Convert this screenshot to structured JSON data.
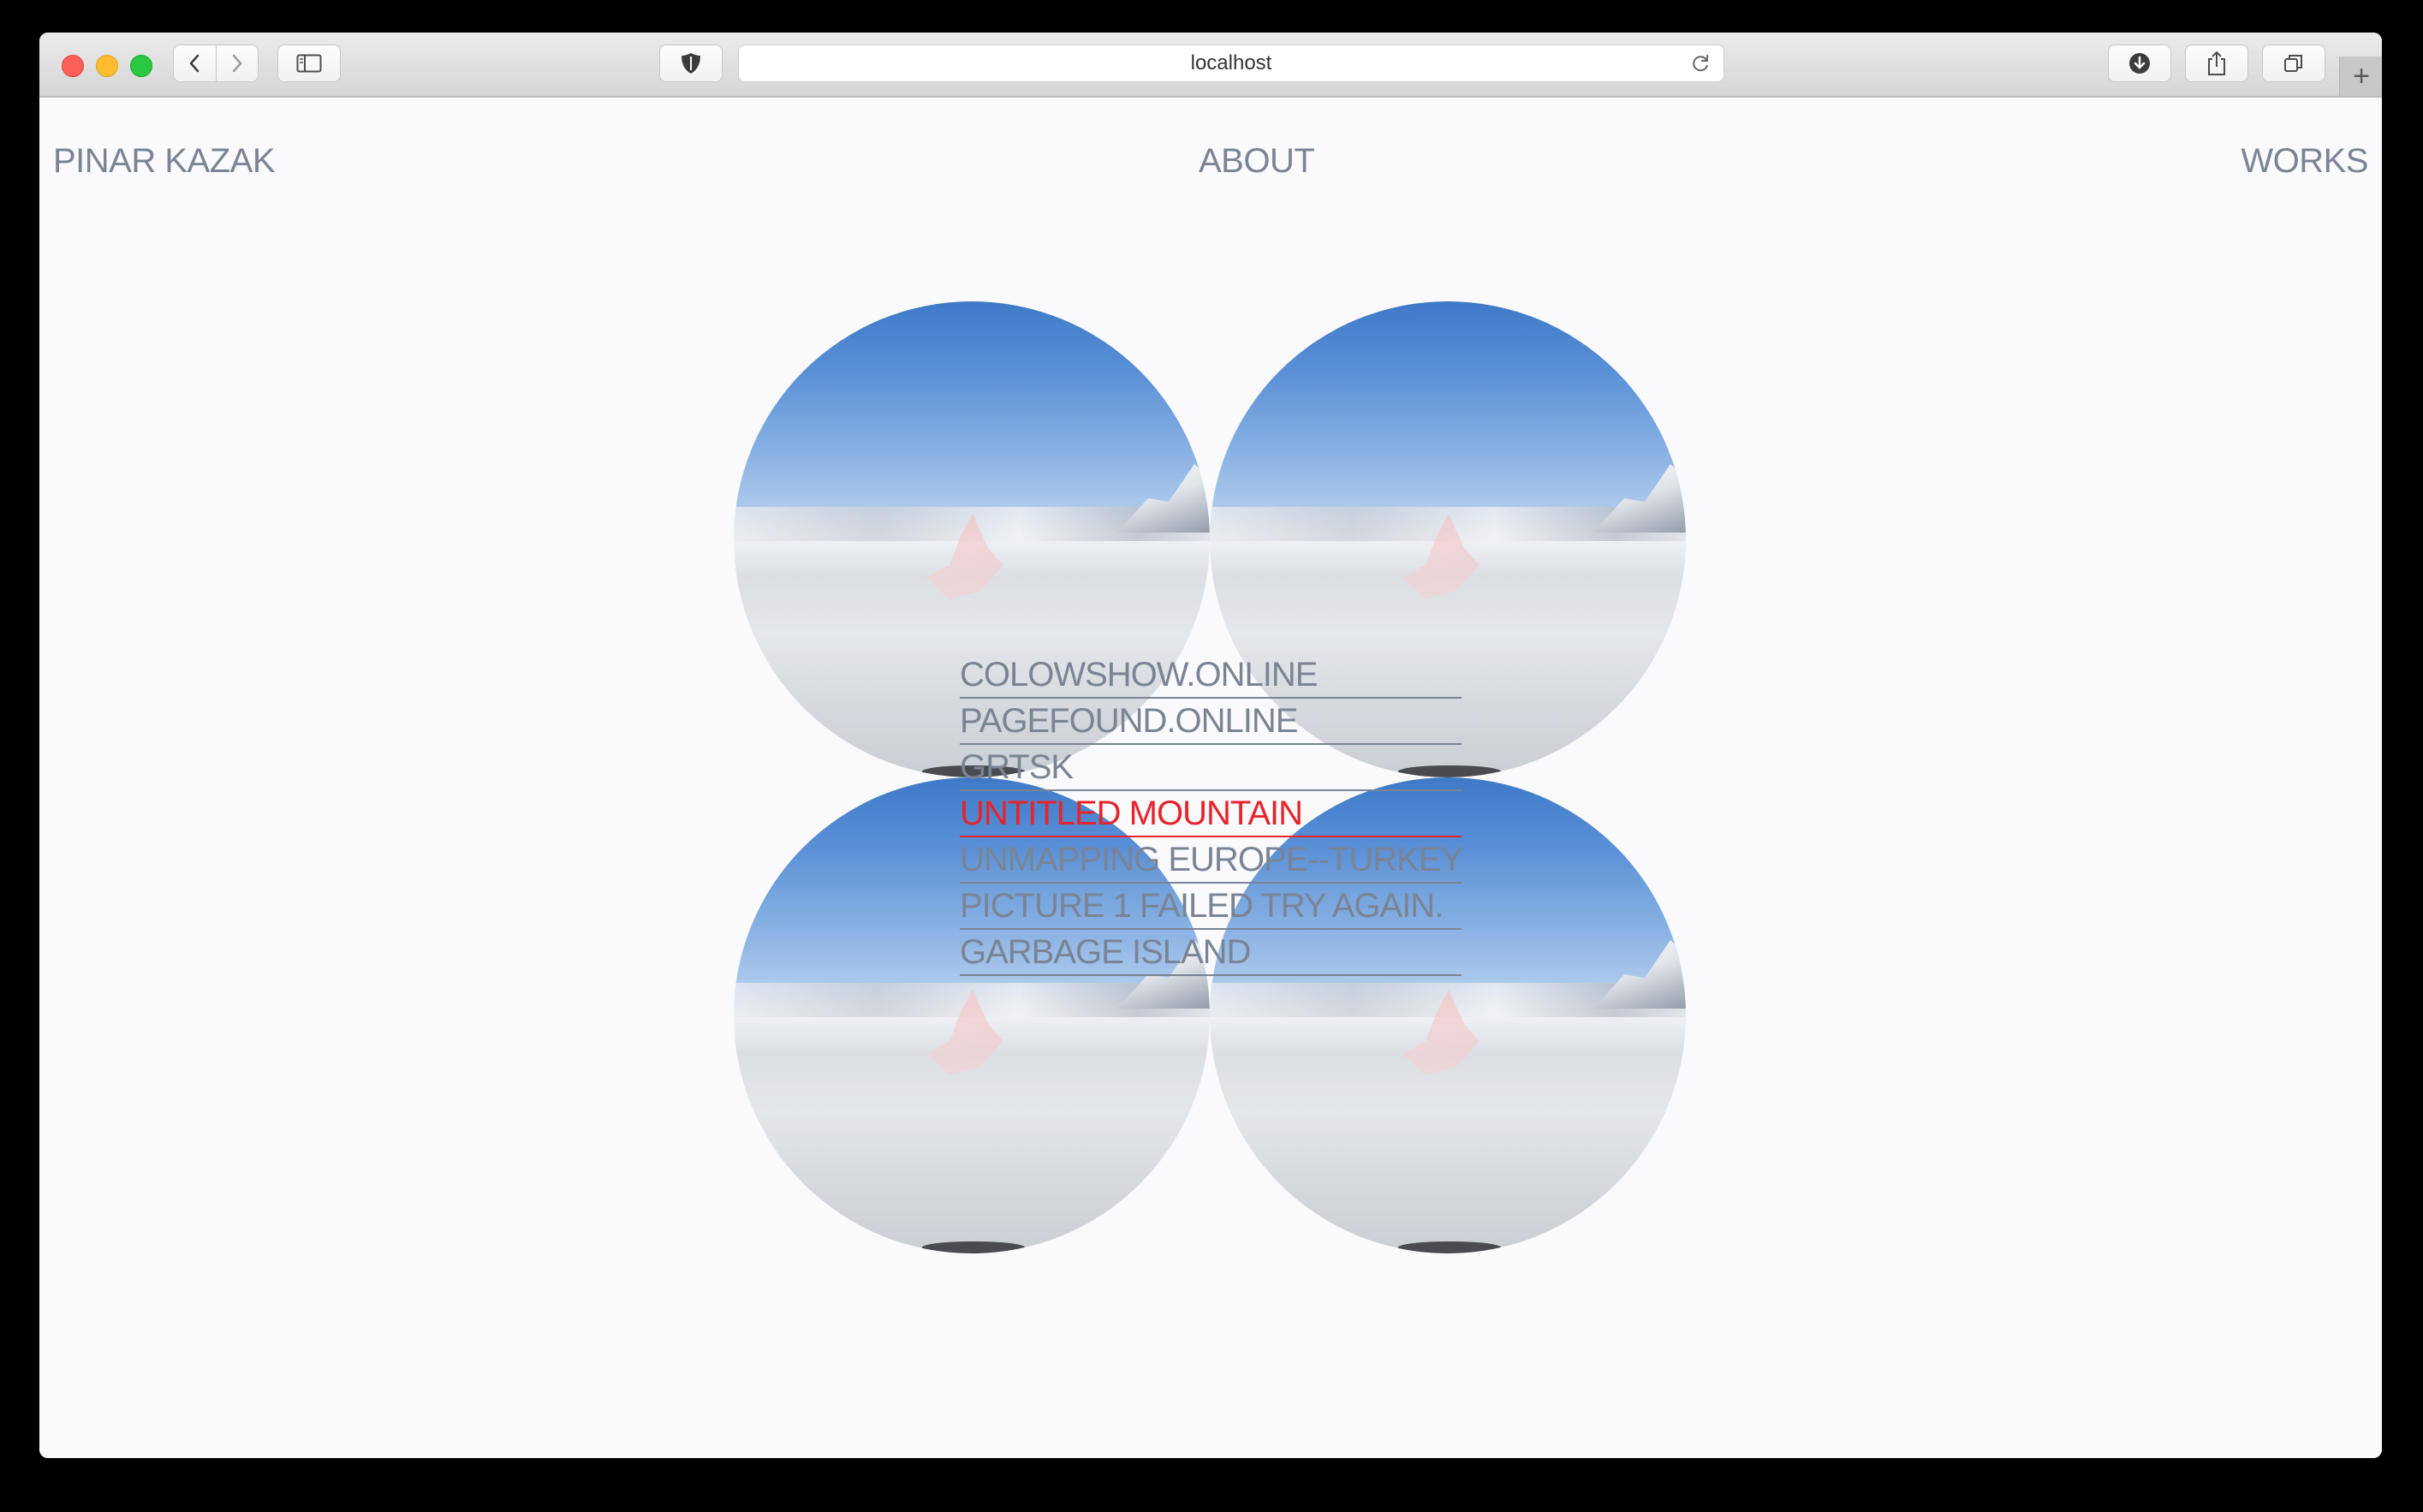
{
  "browser": {
    "address": "localhost",
    "new_tab_label": "+"
  },
  "site": {
    "name": "PINAR KAZAK",
    "nav_about": "ABOUT",
    "nav_works": "WORKS"
  },
  "works": [
    {
      "label": "COLOWSHOW.ONLINE",
      "active": false
    },
    {
      "label": "PAGEFOUND.ONLINE",
      "active": false
    },
    {
      "label": "GRTSK",
      "active": false
    },
    {
      "label": "UNTITLED MOUNTAIN",
      "active": true
    },
    {
      "label": "UNMAPPING EUROPE--TURKEY",
      "active": false
    },
    {
      "label": "PICTURE 1 FAILED TRY AGAIN.",
      "active": false
    },
    {
      "label": "GARBAGE ISLAND",
      "active": false
    }
  ],
  "colors": {
    "text": "#7a8494",
    "active": "#e8232a",
    "background": "#fafafd"
  }
}
